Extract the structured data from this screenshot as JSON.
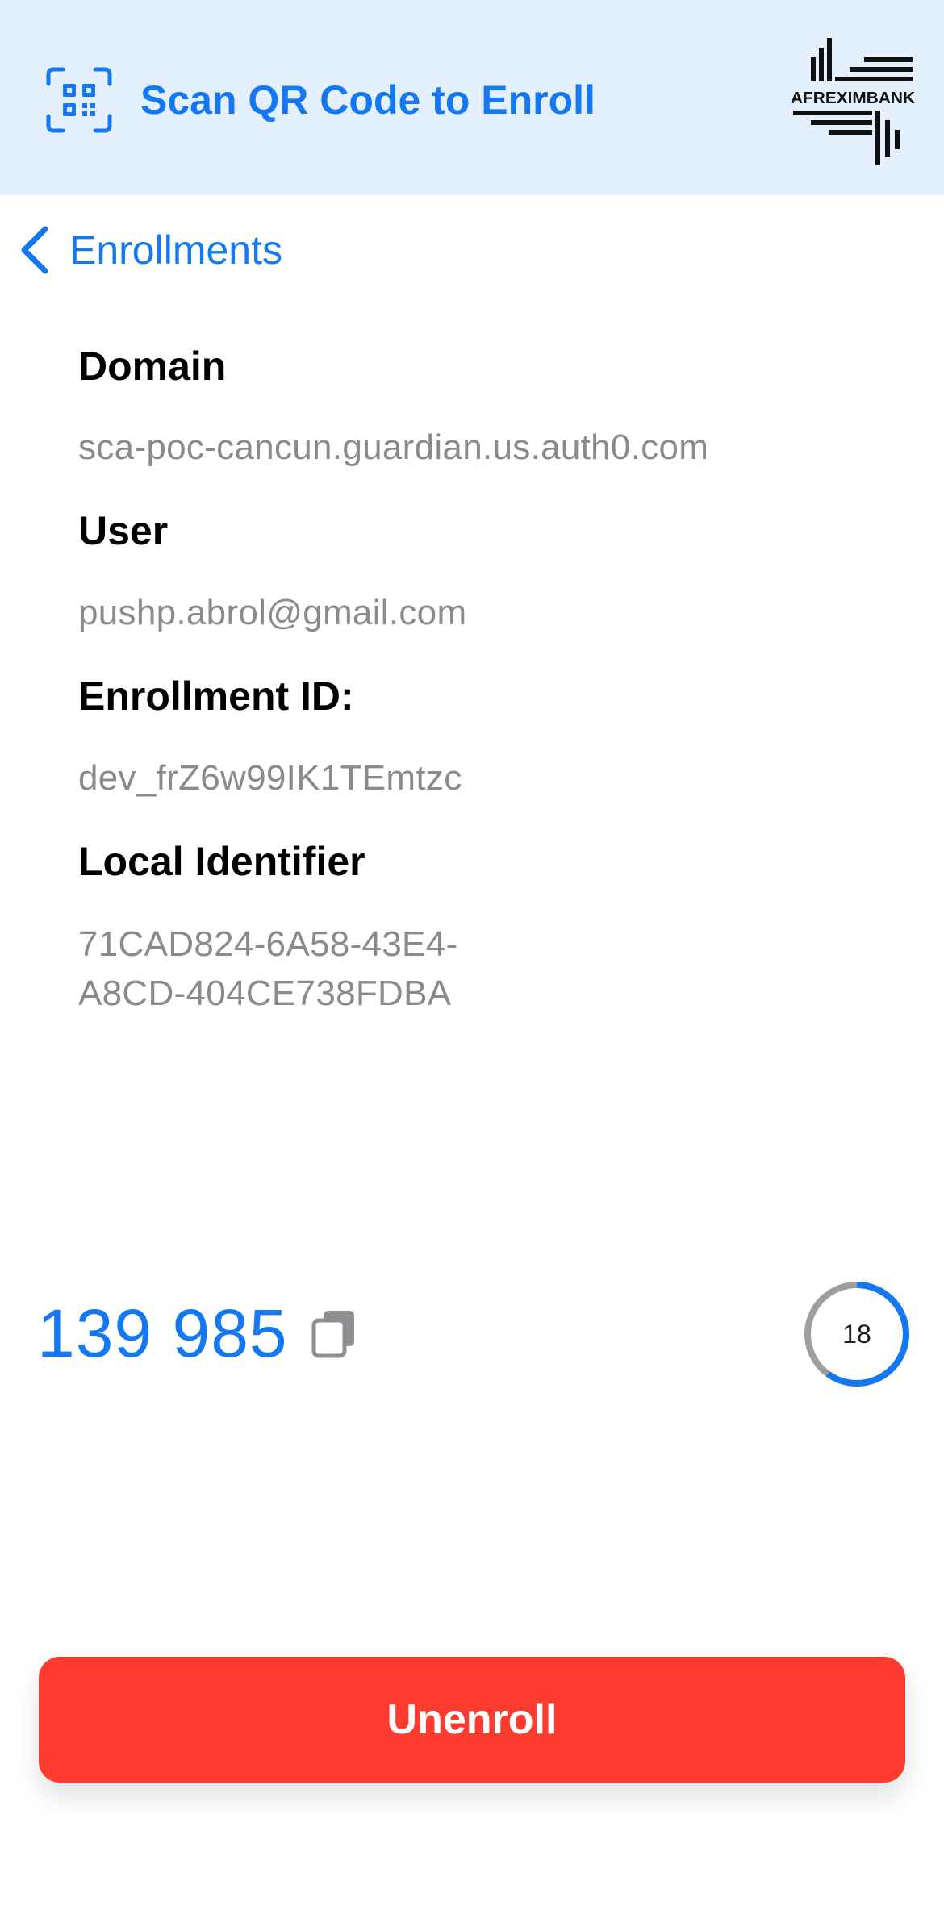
{
  "header": {
    "title": "Scan QR Code to Enroll",
    "icon": "qr-scan-icon",
    "logo_text": "AFREXIMBANK"
  },
  "nav": {
    "back_label": "Enrollments",
    "back_icon": "chevron-left-icon"
  },
  "details": [
    {
      "label": "Domain",
      "value": "sca-poc-cancun.guardian.us.auth0.com"
    },
    {
      "label": "User",
      "value": "pushp.abrol@gmail.com"
    },
    {
      "label": "Enrollment ID:",
      "value": "dev_frZ6w99IK1TEmtzc"
    },
    {
      "label": "Local Identifier",
      "value_lines": [
        "71CAD824-6A58-43E4-",
        "A8CD-404CE738FDBA"
      ]
    }
  ],
  "otp": {
    "code": "139 985",
    "copy_icon": "copy-icon",
    "timer_seconds": "18",
    "timer_progress_fraction": 0.6
  },
  "actions": {
    "unenroll_label": "Unenroll"
  },
  "colors": {
    "accent": "#1478f2",
    "header_bg": "#e4f0fe",
    "destructive": "#ff3b30",
    "secondary_text": "#8a8a8e",
    "timer_track": "#9e9e9e"
  }
}
